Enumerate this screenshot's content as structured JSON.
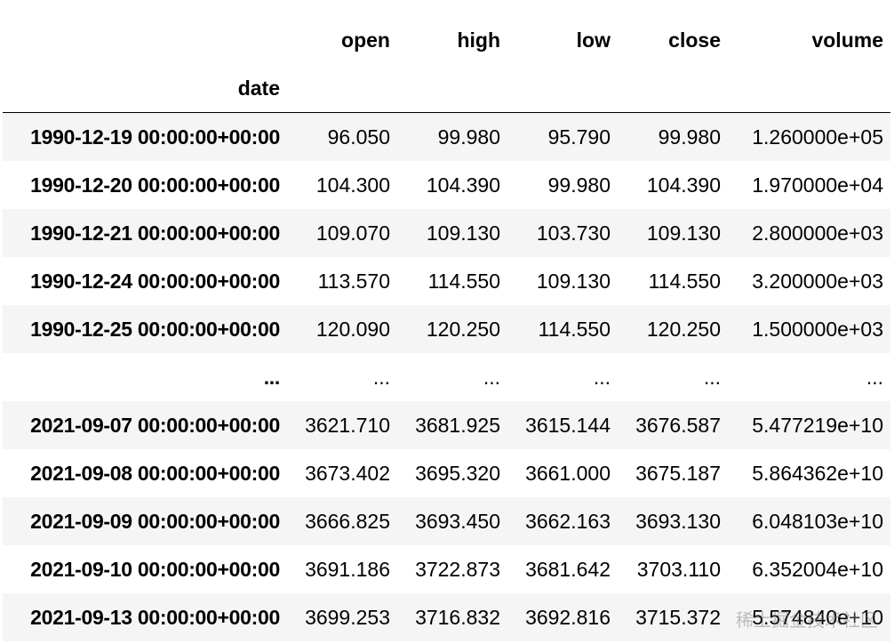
{
  "table": {
    "columns": [
      "open",
      "high",
      "low",
      "close",
      "volume"
    ],
    "index_name": "date",
    "rows": [
      {
        "index": "1990-12-19 00:00:00+00:00",
        "values": [
          "96.050",
          "99.980",
          "95.790",
          "99.980",
          "1.260000e+05"
        ]
      },
      {
        "index": "1990-12-20 00:00:00+00:00",
        "values": [
          "104.300",
          "104.390",
          "99.980",
          "104.390",
          "1.970000e+04"
        ]
      },
      {
        "index": "1990-12-21 00:00:00+00:00",
        "values": [
          "109.070",
          "109.130",
          "103.730",
          "109.130",
          "2.800000e+03"
        ]
      },
      {
        "index": "1990-12-24 00:00:00+00:00",
        "values": [
          "113.570",
          "114.550",
          "109.130",
          "114.550",
          "3.200000e+03"
        ]
      },
      {
        "index": "1990-12-25 00:00:00+00:00",
        "values": [
          "120.090",
          "120.250",
          "114.550",
          "120.250",
          "1.500000e+03"
        ]
      },
      {
        "index": "...",
        "values": [
          "...",
          "...",
          "...",
          "...",
          "..."
        ]
      },
      {
        "index": "2021-09-07 00:00:00+00:00",
        "values": [
          "3621.710",
          "3681.925",
          "3615.144",
          "3676.587",
          "5.477219e+10"
        ]
      },
      {
        "index": "2021-09-08 00:00:00+00:00",
        "values": [
          "3673.402",
          "3695.320",
          "3661.000",
          "3675.187",
          "5.864362e+10"
        ]
      },
      {
        "index": "2021-09-09 00:00:00+00:00",
        "values": [
          "3666.825",
          "3693.450",
          "3662.163",
          "3693.130",
          "6.048103e+10"
        ]
      },
      {
        "index": "2021-09-10 00:00:00+00:00",
        "values": [
          "3691.186",
          "3722.873",
          "3681.642",
          "3703.110",
          "6.352004e+10"
        ]
      },
      {
        "index": "2021-09-13 00:00:00+00:00",
        "values": [
          "3699.253",
          "3716.832",
          "3692.816",
          "3715.372",
          "5.574840e+10"
        ]
      }
    ]
  },
  "watermark": "稀土掘金技术社区"
}
